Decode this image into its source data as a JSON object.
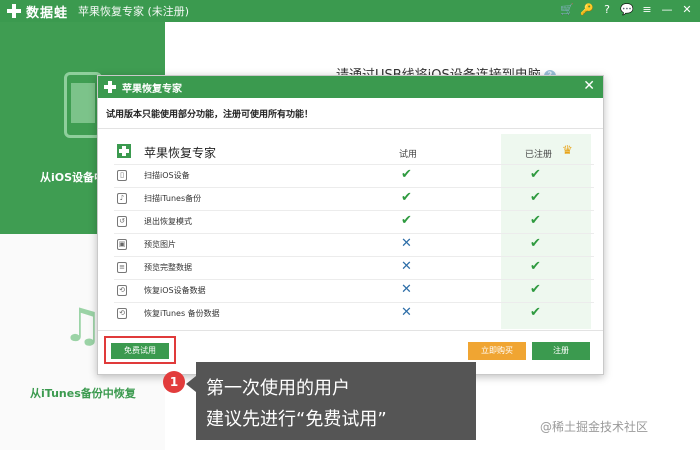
{
  "titlebar": {
    "app_name": "数据蛙",
    "window_title": "苹果恢复专家 (未注册)",
    "icons": [
      "cart-icon",
      "key-icon",
      "help-icon",
      "chat-icon",
      "menu-icon",
      "minimize-icon",
      "close-icon"
    ],
    "icon_glyphs": [
      "🛒",
      "🔑",
      "?",
      "💬",
      "≡",
      "—",
      "✕"
    ]
  },
  "sidebar": {
    "item1_label": "从iOS设备中恢复",
    "item2_label": "从iTunes备份中恢复"
  },
  "main": {
    "hint": "请通过USB线将iOS设备连接到电脑"
  },
  "dialog": {
    "title": "苹果恢复专家",
    "notice": "试用版本只能使用部分功能，注册可使用所有功能！",
    "table": {
      "product_name": "苹果恢复专家",
      "col_trial": "试用",
      "col_registered": "已注册",
      "rows": [
        {
          "icon": "phone-icon",
          "feature": "扫描iOS设备",
          "trial": "check",
          "registered": "check"
        },
        {
          "icon": "music-icon",
          "feature": "扫描iTunes备份",
          "trial": "check",
          "registered": "check"
        },
        {
          "icon": "exit-icon",
          "feature": "退出恢复模式",
          "trial": "check",
          "registered": "check"
        },
        {
          "icon": "image-icon",
          "feature": "预览图片",
          "trial": "cross",
          "registered": "check"
        },
        {
          "icon": "doc-icon",
          "feature": "预览完整数据",
          "trial": "cross",
          "registered": "check"
        },
        {
          "icon": "restore-icon",
          "feature": "恢复iOS设备数据",
          "trial": "cross",
          "registered": "check"
        },
        {
          "icon": "restore-icon",
          "feature": "恢复iTunes 备份数据",
          "trial": "cross",
          "registered": "check"
        }
      ]
    },
    "buttons": {
      "free_trial": "免费试用",
      "buy_now": "立即购买",
      "register": "注册"
    }
  },
  "callout": {
    "step": "1",
    "line1": "第一次使用的用户",
    "line2": "建议先进行“免费试用”"
  },
  "watermark": "@稀土掘金技术社区",
  "colors": {
    "brand_green": "#3b9a4f",
    "buy_orange": "#f0a532",
    "highlight_red": "#e03a3a",
    "cross_blue": "#2d6ea8"
  }
}
